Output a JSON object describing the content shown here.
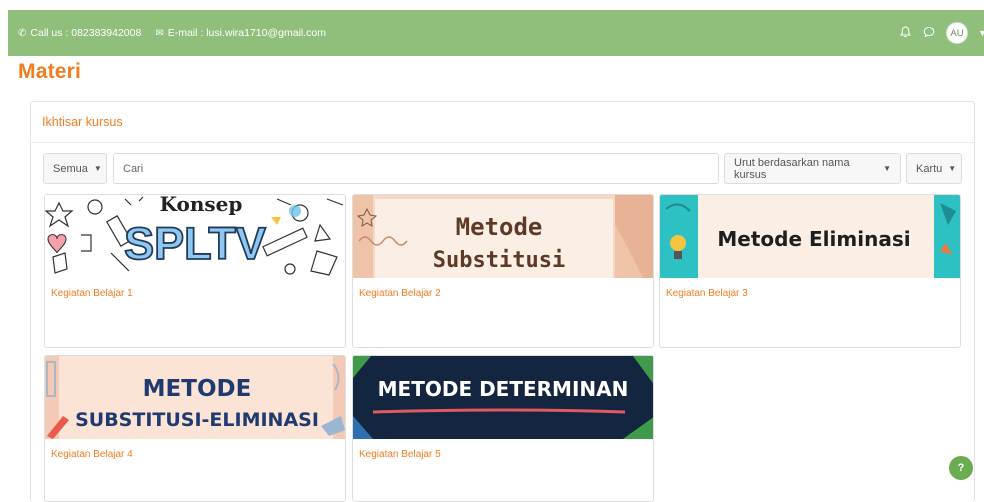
{
  "header": {
    "call_label": "Call us : 082383942008",
    "email_label": "E-mail : lusi.wira1710@gmail.com",
    "avatar_initials": "AU"
  },
  "page": {
    "title": "Materi"
  },
  "overview": {
    "heading": "Ikhtisar kursus",
    "filter_value": "Semua",
    "search_placeholder": "Cari",
    "sort_value": "Urut berdasarkan nama kursus",
    "view_value": "Kartu"
  },
  "courses": [
    {
      "title": "Kegiatan Belajar 1",
      "image_text_top": "Konsep",
      "image_text_main": "SPLTV"
    },
    {
      "title": "Kegiatan Belajar 2",
      "image_text_top": "Metode",
      "image_text_main": "Substitusi"
    },
    {
      "title": "Kegiatan Belajar 3",
      "image_text_main": "Metode Eliminasi"
    },
    {
      "title": "Kegiatan Belajar 4",
      "image_text_top": "METODE",
      "image_text_main": "SUBSTITUSI-ELIMINASI"
    },
    {
      "title": "Kegiatan Belajar 5",
      "image_text_main": "METODE DETERMINAN"
    }
  ],
  "help": {
    "label": "?"
  },
  "colors": {
    "header_bg": "#8fbf7a",
    "accent": "#f47c20",
    "help_bg": "#6aad50"
  }
}
